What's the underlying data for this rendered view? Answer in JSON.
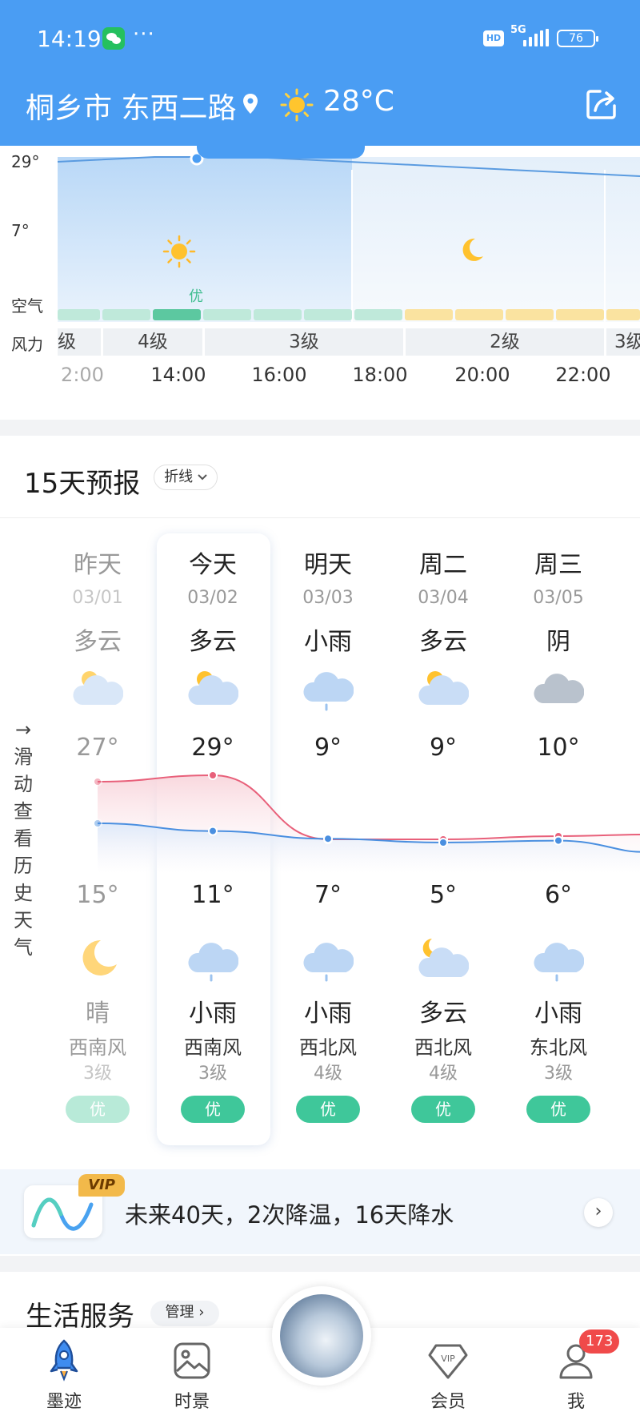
{
  "status_bar": {
    "time": "14:19",
    "dots": "···",
    "hd": "HD",
    "network": "5G",
    "battery": "76"
  },
  "header": {
    "location": "桐乡市 东西二路",
    "temperature": "28°C",
    "weather_icon": "sun-icon",
    "share_icon": "share-icon"
  },
  "hourly": {
    "y_labels": [
      "29°",
      "7°"
    ],
    "row_labels": {
      "air": "空气",
      "wind": "风力"
    },
    "air_label": "优",
    "wind_segments": [
      "级",
      "4级",
      "3级",
      "2级",
      "3级"
    ],
    "times": [
      "2:00",
      "14:00",
      "16:00",
      "18:00",
      "20:00",
      "22:00"
    ],
    "temp_values_celsius": [
      28,
      29,
      29,
      28,
      27,
      26,
      25
    ]
  },
  "forecast": {
    "title": "15天预报",
    "mode": "折线",
    "side_hint": "→滑动查看历史天气",
    "days": [
      {
        "day": "昨天",
        "date": "03/01",
        "day_cond": "多云",
        "high": "27°",
        "low": "15°",
        "night_cond": "晴",
        "wind_dir": "西南风",
        "wind_level": "3级",
        "aqi": "优"
      },
      {
        "day": "今天",
        "date": "03/02",
        "day_cond": "多云",
        "high": "29°",
        "low": "11°",
        "night_cond": "小雨",
        "wind_dir": "西南风",
        "wind_level": "3级",
        "aqi": "优"
      },
      {
        "day": "明天",
        "date": "03/03",
        "day_cond": "小雨",
        "high": "9°",
        "low": "7°",
        "night_cond": "小雨",
        "wind_dir": "西北风",
        "wind_level": "4级",
        "aqi": "优"
      },
      {
        "day": "周二",
        "date": "03/04",
        "day_cond": "多云",
        "high": "9°",
        "low": "5°",
        "night_cond": "多云",
        "wind_dir": "西北风",
        "wind_level": "4级",
        "aqi": "优"
      },
      {
        "day": "周三",
        "date": "03/05",
        "day_cond": "阴",
        "high": "10°",
        "low": "6°",
        "night_cond": "小雨",
        "wind_dir": "东北风",
        "wind_level": "3级",
        "aqi": "优"
      }
    ],
    "highs": [
      27,
      29,
      9,
      9,
      10
    ],
    "lows": [
      15,
      11,
      7,
      5,
      6
    ],
    "colors": {
      "high_line": "#e8607a",
      "low_line": "#4a8fe0",
      "aqi_good": "#3fc79a"
    }
  },
  "banner": {
    "vip": "VIP",
    "text": "未来40天，2次降温，16天降水",
    "arrow": "›"
  },
  "services": {
    "title": "生活服务",
    "manage": "管理 ›"
  },
  "nav": {
    "items": [
      "墨迹",
      "时景",
      "会员",
      "我"
    ],
    "badge": "173",
    "vip_glyph": "VIP"
  }
}
